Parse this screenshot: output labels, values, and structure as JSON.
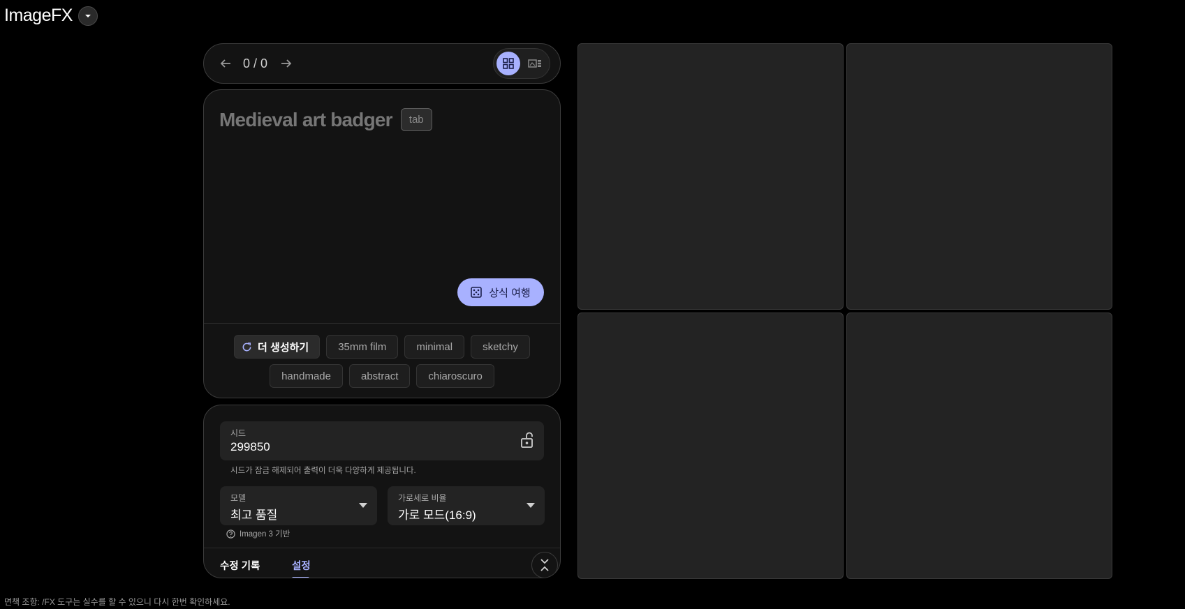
{
  "app": {
    "title": "ImageFX",
    "menu_icon": "chevron-down-icon"
  },
  "pager": {
    "counter": "0 / 0",
    "prev_icon": "arrow-left-icon",
    "next_icon": "arrow-right-icon",
    "views": [
      {
        "name": "grid-view",
        "icon": "grid-icon",
        "active": true
      },
      {
        "name": "single-view",
        "icon": "filmstrip-icon",
        "active": false
      }
    ]
  },
  "prompt": {
    "text": "Medieval art badger",
    "tab_hint": "tab",
    "lucky_label": "상식 여행",
    "lucky_icon": "dice-icon"
  },
  "chips": {
    "generate_more": "더 생성하기",
    "row1": [
      "35mm film",
      "minimal",
      "sketchy"
    ],
    "row2": [
      "handmade",
      "abstract",
      "chiaroscuro"
    ]
  },
  "settings": {
    "seed": {
      "label": "시드",
      "value": "299850",
      "icon": "unlock-icon",
      "hint": "시드가 잠금 해제되어 출력이 더욱 다양하게 제공됩니다."
    },
    "model": {
      "label": "모델",
      "value": "최고 품질"
    },
    "ratio": {
      "label": "가로세로 비율",
      "value": "가로 모드(16:9)"
    },
    "imagen_note": "Imagen 3 기반"
  },
  "tabs": {
    "history": "수정 기록",
    "settings": "설정",
    "active": "settings",
    "collapse_icon": "collapse-icon"
  },
  "footer": {
    "disclaimer": "면책 조항: /FX 도구는 실수를 할 수 있으니 다시 한번 확인하세요."
  },
  "colors": {
    "accent": "#a8b1ff",
    "background": "#000000",
    "card": "#131313",
    "tile": "#232323"
  }
}
